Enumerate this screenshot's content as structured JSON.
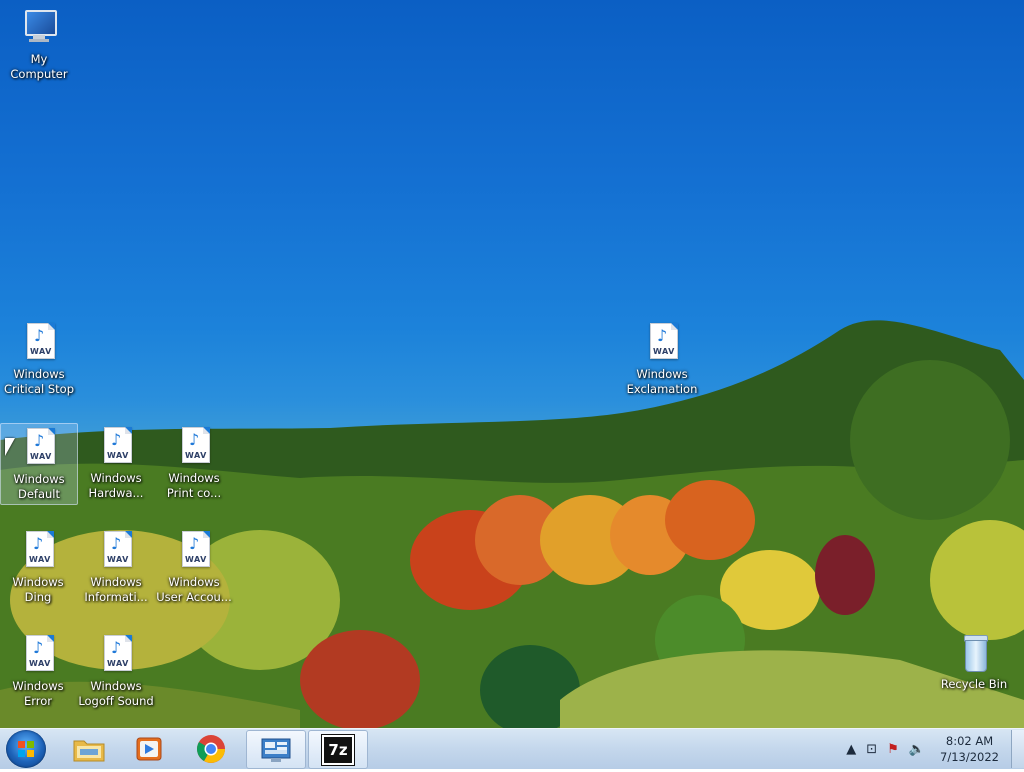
{
  "desktop": {
    "icons": [
      {
        "name": "my-computer",
        "label": "My Computer",
        "type": "computer"
      },
      {
        "name": "windows-critical-stop",
        "label": "Windows\nCritical Stop",
        "type": "wav"
      },
      {
        "name": "windows-exclamation",
        "label": "Windows\nExclamation",
        "type": "wav"
      },
      {
        "name": "windows-default",
        "label": "Windows\nDefault",
        "type": "wav"
      },
      {
        "name": "windows-hardware",
        "label": "Windows\nHardwa...",
        "type": "wav"
      },
      {
        "name": "windows-print-complete",
        "label": "Windows\nPrint co...",
        "type": "wav"
      },
      {
        "name": "windows-ding",
        "label": "Windows\nDing",
        "type": "wav"
      },
      {
        "name": "windows-information",
        "label": "Windows\nInformati...",
        "type": "wav"
      },
      {
        "name": "windows-user-account",
        "label": "Windows\nUser Accou...",
        "type": "wav"
      },
      {
        "name": "windows-error",
        "label": "Windows\nError",
        "type": "wav"
      },
      {
        "name": "windows-logoff-sound",
        "label": "Windows\nLogoff Sound",
        "type": "wav"
      },
      {
        "name": "recycle-bin",
        "label": "Recycle Bin",
        "type": "recycle"
      }
    ],
    "wav_tag": "WAV"
  },
  "taskbar": {
    "pinned": [
      {
        "name": "file-explorer",
        "icon": "folder-icon"
      },
      {
        "name": "media-player",
        "icon": "media-player-icon"
      },
      {
        "name": "chrome",
        "icon": "chrome-icon"
      },
      {
        "name": "control-panel",
        "icon": "control-panel-icon"
      },
      {
        "name": "7zip",
        "icon": "7zip-icon",
        "text": "7z"
      }
    ],
    "clock": {
      "time": "8:02 AM",
      "date": "7/13/2022"
    }
  }
}
